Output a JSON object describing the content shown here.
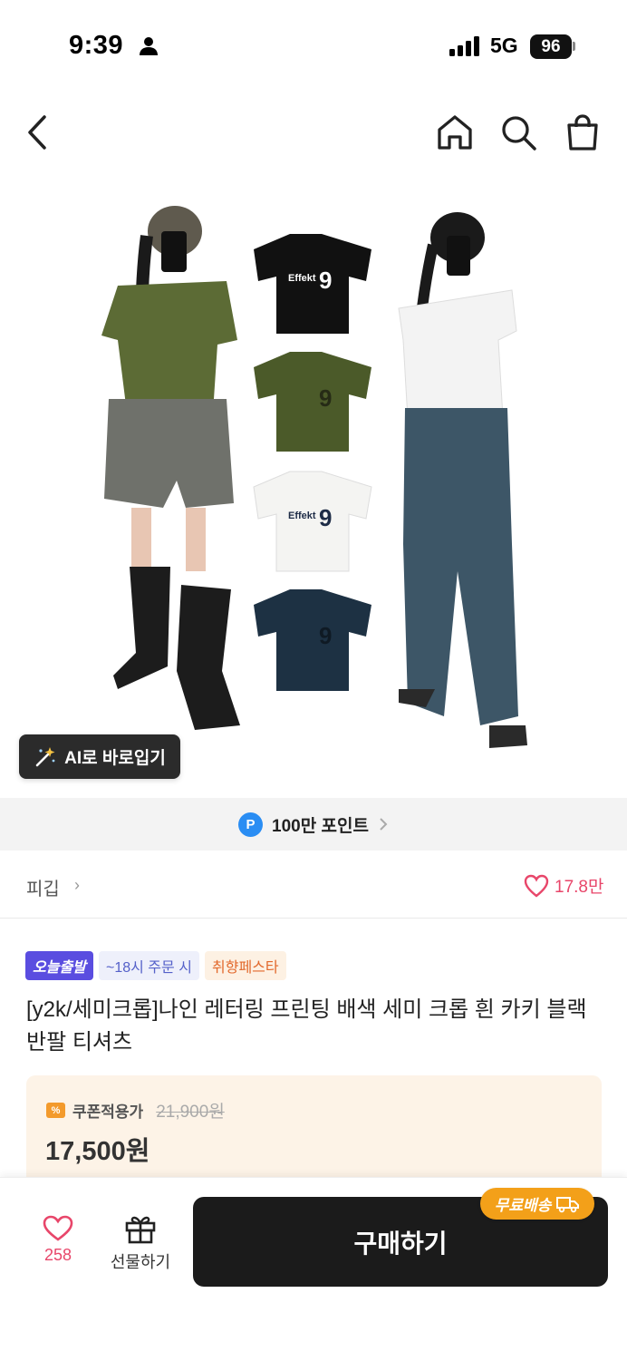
{
  "status_bar": {
    "time": "9:39",
    "network": "5G",
    "battery": "96"
  },
  "nav": {
    "back_icon": "chevron-left-icon",
    "home_icon": "home-icon",
    "search_icon": "search-icon",
    "cart_icon": "shopping-bag-icon"
  },
  "product_image": {
    "ai_button_label": "AI로 바로입기",
    "ai_icon": "magic-wand-icon"
  },
  "points_banner": {
    "badge": "P",
    "text": "100만 포인트"
  },
  "shop": {
    "name": "피깁",
    "chevron": "›",
    "likes": "17.8만"
  },
  "badges": {
    "today_ship": "오늘출발",
    "order_deadline": "~18시 주문 시",
    "festa": "취향페스타"
  },
  "product": {
    "title": "[y2k/세미크롭]나인 레터링 프린팅 배색 세미 크롭 흰 카키 블랙 반팔 티셔츠"
  },
  "price": {
    "coupon_label": "쿠폰적용가",
    "original": "21,900원",
    "final": "17,500원"
  },
  "bottom_bar": {
    "wish_count": "258",
    "gift_label": "선물하기",
    "buy_label": "구매하기",
    "free_shipping": "무료배송"
  },
  "colors": {
    "accent_pink": "#e8466a",
    "points_blue": "#2a8df3",
    "badge_purple": "#5a4de0",
    "free_ship_orange": "#f3a019",
    "buy_button": "#1b1b1b"
  }
}
